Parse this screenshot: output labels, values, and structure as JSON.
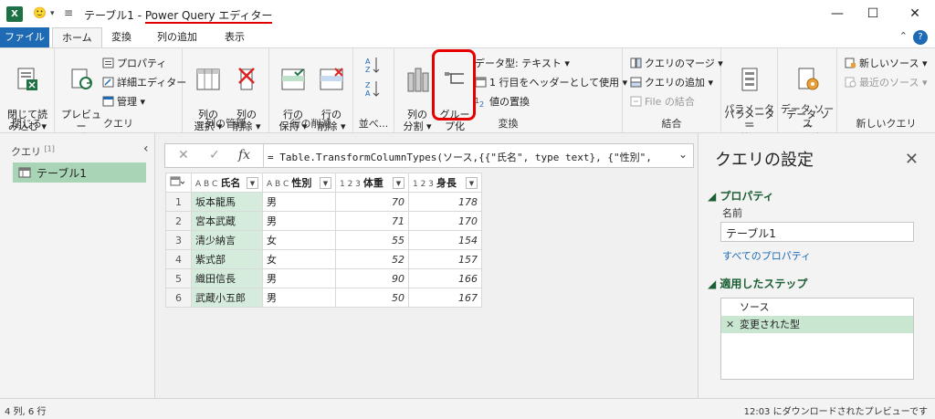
{
  "titlebar": {
    "app_icon_label": "X",
    "title_prefix": "テーブル1 - ",
    "title_app": "Power Query エディター",
    "smiley": "🙂",
    "qat_arrow": "▾",
    "qat_custom": "≡",
    "minimize": "—",
    "maximize": "☐",
    "close": "✕"
  },
  "tabs": {
    "file": "ファイル",
    "home": "ホーム",
    "transform": "変換",
    "add_column": "列の追加",
    "view": "表示",
    "collapse": "⌃",
    "help": "?"
  },
  "ribbon": {
    "close_group": {
      "btn": "閉じて読\nみ込む ▾",
      "label": "閉じる"
    },
    "query_group": {
      "refresh": "プレビュー\nの更新 ▾",
      "properties": "プロパティ",
      "advanced_editor": "詳細エディター",
      "manage": "管理 ▾",
      "label": "クエリ"
    },
    "manage_cols_group": {
      "choose": "列の\n選択 ▾",
      "remove": "列の\n削除 ▾",
      "label": "列の管理"
    },
    "reduce_rows_group": {
      "keep": "行の\n保持 ▾",
      "remove": "行の\n削除 ▾",
      "label": "行の削減"
    },
    "sort_group": {
      "label": "並べ..."
    },
    "transform_group": {
      "split": "列の\n分割 ▾",
      "group_by": "グルー\nプ化",
      "data_type": "データ型: テキスト ▾",
      "header": "1 行目をヘッダーとして使用 ▾",
      "replace": "値の置換",
      "label": "変換"
    },
    "combine_group": {
      "merge": "クエリのマージ ▾",
      "append": "クエリの追加 ▾",
      "file_combine": "File の結合",
      "label": "結合"
    },
    "params_group": {
      "btn": "パラメーター\nの管理 ▾",
      "label": "パラメーター"
    },
    "datasource_group": {
      "btn": "データ ソー\nス設定",
      "label": "データ ソース"
    },
    "newquery_group": {
      "new_source": "新しいソース ▾",
      "recent": "最近のソース ▾",
      "label": "新しいクエリ"
    }
  },
  "left_pane": {
    "header": "クエリ",
    "count": "[1]",
    "collapse": "‹",
    "item": "テーブル1"
  },
  "formula": {
    "cancel": "✕",
    "confirm": "✓",
    "fx": "fx",
    "text": "= Table.TransformColumnTypes(ソース,{{\"氏名\", type text}, {\"性別\",",
    "expand": "⌄"
  },
  "table": {
    "columns": [
      {
        "type": "A B C",
        "name": "氏名"
      },
      {
        "type": "A B C",
        "name": "性別"
      },
      {
        "type": "1 2 3",
        "name": "体重"
      },
      {
        "type": "1 2 3",
        "name": "身長"
      }
    ],
    "rows": [
      {
        "n": "1",
        "name": "坂本龍馬",
        "sex": "男",
        "weight": "70",
        "height": "178"
      },
      {
        "n": "2",
        "name": "宮本武蔵",
        "sex": "男",
        "weight": "71",
        "height": "170"
      },
      {
        "n": "3",
        "name": "清少納言",
        "sex": "女",
        "weight": "55",
        "height": "154"
      },
      {
        "n": "4",
        "name": "紫式部",
        "sex": "女",
        "weight": "52",
        "height": "157"
      },
      {
        "n": "5",
        "name": "織田信長",
        "sex": "男",
        "weight": "90",
        "height": "166"
      },
      {
        "n": "6",
        "name": "武蔵小五郎",
        "sex": "男",
        "weight": "50",
        "height": "167"
      }
    ]
  },
  "right_pane": {
    "title": "クエリの設定",
    "close": "✕",
    "properties": "◢ プロパティ",
    "name_label": "名前",
    "name_value": "テーブル1",
    "all_properties": "すべてのプロパティ",
    "applied_steps": "◢ 適用したステップ",
    "steps": [
      "ソース",
      "変更された型"
    ],
    "step_delete": "✕"
  },
  "status": {
    "left": "4 列, 6 行",
    "right": "12:03 にダウンロードされたプレビューです"
  },
  "colors": {
    "excel_green": "#1e7145",
    "file_tab_blue": "#1e6ab5",
    "highlight_red": "#e60000",
    "query_selected": "#a9d4b6",
    "section_green": "#1a5e33"
  }
}
